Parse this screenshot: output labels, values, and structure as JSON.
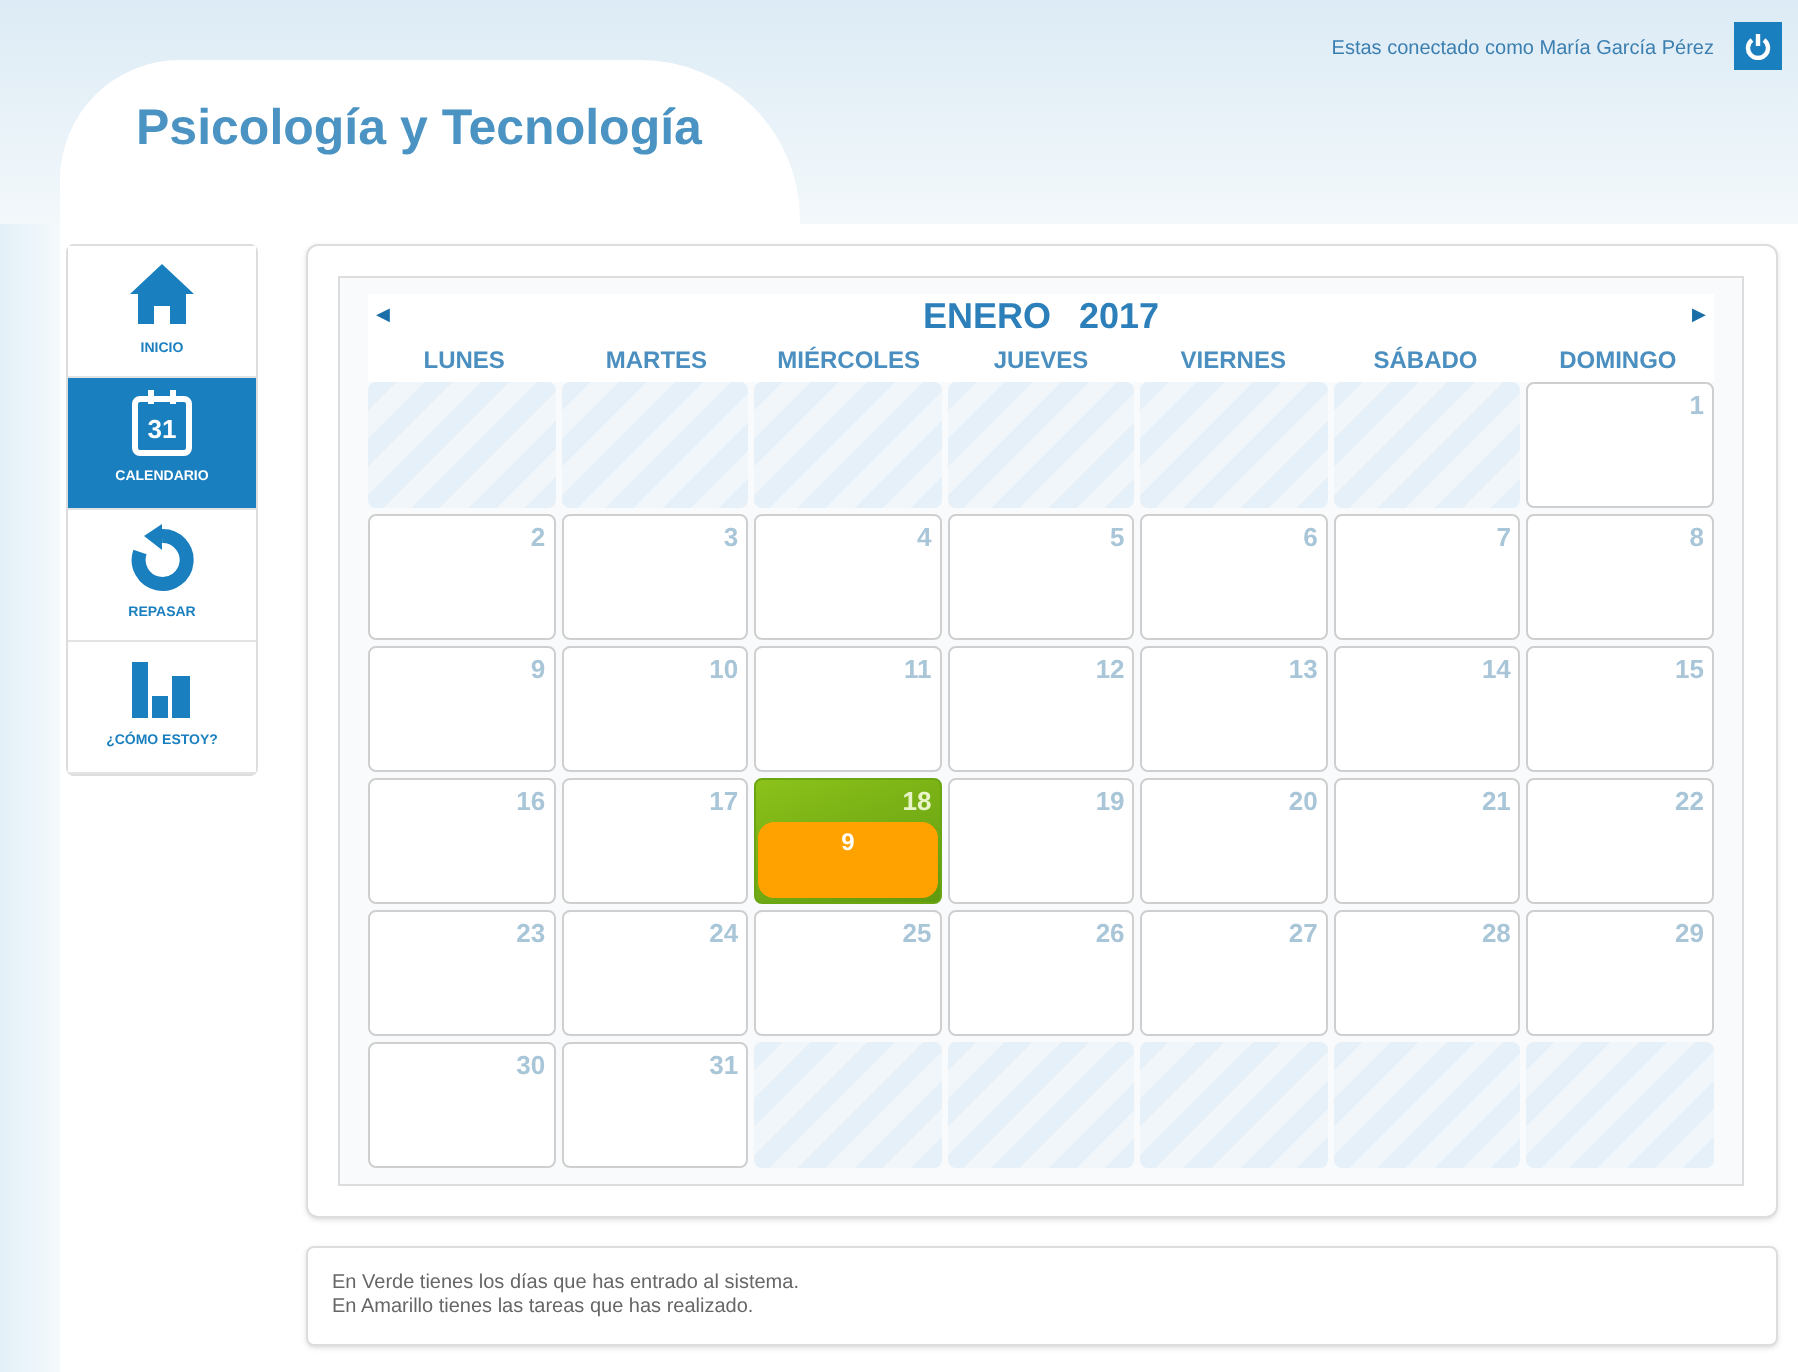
{
  "header": {
    "title": "Psicología y Tecnología",
    "user_text": "Estas conectado como María García Pérez"
  },
  "sidebar": {
    "items": [
      {
        "label": "INICIO",
        "kind": "home",
        "selected": false
      },
      {
        "label": "CALENDARIO",
        "kind": "calendar",
        "icon_text": "31",
        "selected": true
      },
      {
        "label": "REPASAR",
        "kind": "review",
        "selected": false
      },
      {
        "label": "¿CÓMO ESTOY?",
        "kind": "progress",
        "selected": false
      }
    ]
  },
  "calendar": {
    "month": "ENERO",
    "year": "2017",
    "prev": "◀",
    "next": "▶",
    "weekdays": [
      "LUNES",
      "MARTES",
      "MIÉRCOLES",
      "JUEVES",
      "VIERNES",
      "SÁBADO",
      "DOMINGO"
    ],
    "cells": [
      {
        "kind": "empty"
      },
      {
        "kind": "empty"
      },
      {
        "kind": "empty"
      },
      {
        "kind": "empty"
      },
      {
        "kind": "empty"
      },
      {
        "kind": "empty"
      },
      {
        "kind": "day",
        "day": "1",
        "visited": false
      },
      {
        "kind": "day",
        "day": "2",
        "visited": false
      },
      {
        "kind": "day",
        "day": "3",
        "visited": false
      },
      {
        "kind": "day",
        "day": "4",
        "visited": false
      },
      {
        "kind": "day",
        "day": "5",
        "visited": false
      },
      {
        "kind": "day",
        "day": "6",
        "visited": false
      },
      {
        "kind": "day",
        "day": "7",
        "visited": false
      },
      {
        "kind": "day",
        "day": "8",
        "visited": false
      },
      {
        "kind": "day",
        "day": "9",
        "visited": false
      },
      {
        "kind": "day",
        "day": "10",
        "visited": false
      },
      {
        "kind": "day",
        "day": "11",
        "visited": false
      },
      {
        "kind": "day",
        "day": "12",
        "visited": false
      },
      {
        "kind": "day",
        "day": "13",
        "visited": false
      },
      {
        "kind": "day",
        "day": "14",
        "visited": false
      },
      {
        "kind": "day",
        "day": "15",
        "visited": false
      },
      {
        "kind": "day",
        "day": "16",
        "visited": false
      },
      {
        "kind": "day",
        "day": "17",
        "visited": false
      },
      {
        "kind": "day",
        "day": "18",
        "visited": true,
        "tasks": "9"
      },
      {
        "kind": "day",
        "day": "19",
        "visited": false
      },
      {
        "kind": "day",
        "day": "20",
        "visited": false
      },
      {
        "kind": "day",
        "day": "21",
        "visited": false
      },
      {
        "kind": "day",
        "day": "22",
        "visited": false
      },
      {
        "kind": "day",
        "day": "23",
        "visited": false
      },
      {
        "kind": "day",
        "day": "24",
        "visited": false
      },
      {
        "kind": "day",
        "day": "25",
        "visited": false
      },
      {
        "kind": "day",
        "day": "26",
        "visited": false
      },
      {
        "kind": "day",
        "day": "27",
        "visited": false
      },
      {
        "kind": "day",
        "day": "28",
        "visited": false
      },
      {
        "kind": "day",
        "day": "29",
        "visited": false
      },
      {
        "kind": "day",
        "day": "30",
        "visited": false
      },
      {
        "kind": "day",
        "day": "31",
        "visited": false
      },
      {
        "kind": "empty"
      },
      {
        "kind": "empty"
      },
      {
        "kind": "empty"
      },
      {
        "kind": "empty"
      },
      {
        "kind": "empty"
      }
    ]
  },
  "legend": [
    "En Verde tienes los días que has entrado al sistema.",
    "En Amarillo tienes las tareas que has realizado."
  ]
}
